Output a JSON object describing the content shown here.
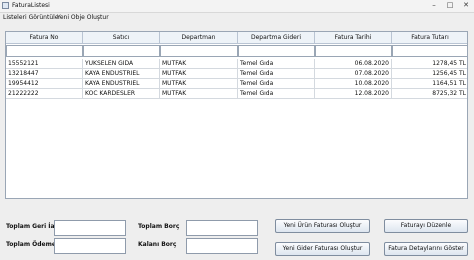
{
  "window": {
    "title": "FaturaListesi",
    "min_glyph": "–",
    "max_glyph": "□",
    "close_glyph": "✕"
  },
  "menu": {
    "items": [
      "Listeleri Görüntüle",
      "Yeni Obje Oluştur"
    ]
  },
  "table": {
    "columns": [
      "Fatura No",
      "Satıcı",
      "Departman",
      "Departma Gideri",
      "Fatura Tarihi",
      "Fatura Tutarı"
    ],
    "rows": [
      [
        "15552121",
        "YUKSELEN GIDA",
        "MUTFAK",
        "Temel Gıda",
        "06.08.2020",
        "1278,45 TL"
      ],
      [
        "13218447",
        "KAYA ENDUSTRIEL",
        "MUTFAK",
        "Temel Gıda",
        "07.08.2020",
        "1256,45 TL"
      ],
      [
        "19954412",
        "KAYA ENDUSTRIEL",
        "MUTFAK",
        "Temel Gıda",
        "10.08.2020",
        "1164,51 TL"
      ],
      [
        "21222222",
        "KOC KARDESLER",
        "MUTFAK",
        "Temel Gıda",
        "12.08.2020",
        "8725,32 TL"
      ]
    ]
  },
  "form": {
    "toplam_geri_iade_label": "Toplam Geri İade",
    "toplam_odeme_label": "Toplam Ödeme",
    "toplam_borc_label": "Toplam Borç",
    "kalan_borc_label": "Kalanı Borç"
  },
  "buttons": {
    "yeni_urun": "Yeni Ürün Faturası Oluştur",
    "faturayi_duzenle": "Faturayı Düzenle",
    "yeni_gider": "Yeni Gider Faturası Oluştur",
    "fatura_detaylari": "Fatura Detaylarını Göster"
  }
}
